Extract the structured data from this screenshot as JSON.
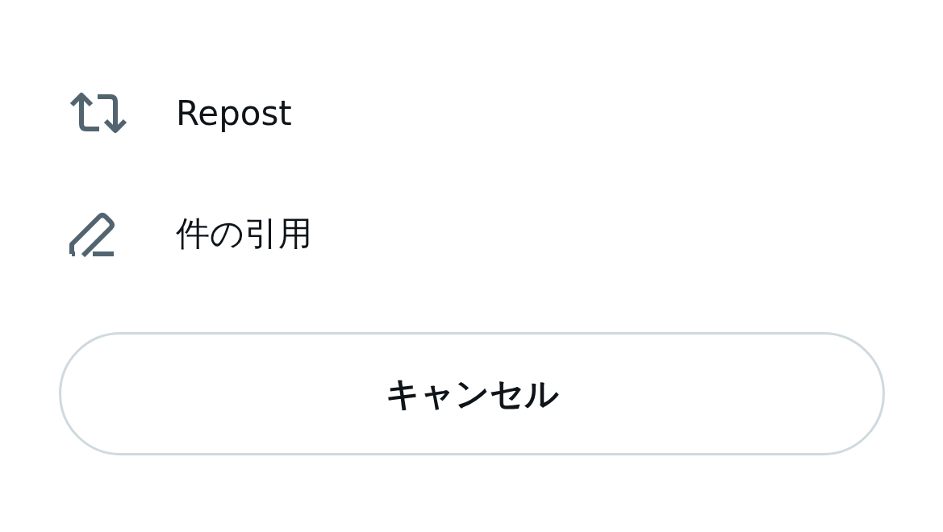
{
  "menu": {
    "items": [
      {
        "kind": "repost",
        "label": "Repost"
      },
      {
        "kind": "quote",
        "label": "件の引用"
      }
    ]
  },
  "cancel_button": {
    "label": "キャンセル"
  }
}
